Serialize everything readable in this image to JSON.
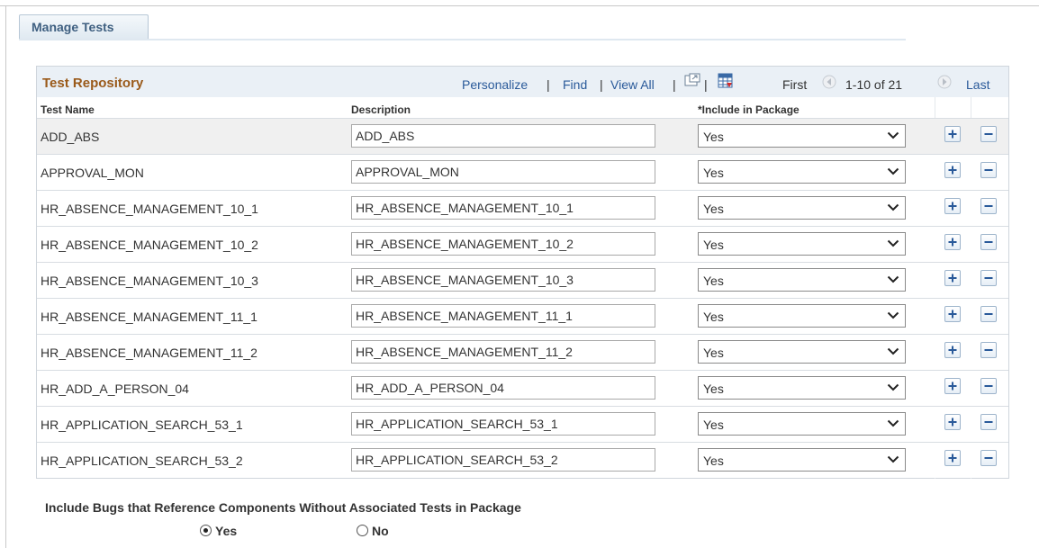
{
  "tab": {
    "label": "Manage Tests"
  },
  "grid": {
    "title": "Test Repository",
    "nav": {
      "personalize": "Personalize",
      "find": "Find",
      "view_all": "View All",
      "first": "First",
      "range": "1-10 of 21",
      "last": "Last"
    },
    "icons": [
      "zoom-icon",
      "download-spreadsheet-icon",
      "prev-arrow-icon",
      "next-arrow-icon",
      "add-row-icon",
      "delete-row-icon"
    ],
    "columns": [
      "Test Name",
      "Description",
      "*Include in Package"
    ],
    "rows": [
      {
        "name": "ADD_ABS",
        "description": "ADD_ABS",
        "include": "Yes"
      },
      {
        "name": "APPROVAL_MON",
        "description": "APPROVAL_MON",
        "include": "Yes"
      },
      {
        "name": "HR_ABSENCE_MANAGEMENT_10_1",
        "description": "HR_ABSENCE_MANAGEMENT_10_1",
        "include": "Yes"
      },
      {
        "name": "HR_ABSENCE_MANAGEMENT_10_2",
        "description": "HR_ABSENCE_MANAGEMENT_10_2",
        "include": "Yes"
      },
      {
        "name": "HR_ABSENCE_MANAGEMENT_10_3",
        "description": "HR_ABSENCE_MANAGEMENT_10_3",
        "include": "Yes"
      },
      {
        "name": "HR_ABSENCE_MANAGEMENT_11_1",
        "description": "HR_ABSENCE_MANAGEMENT_11_1",
        "include": "Yes"
      },
      {
        "name": "HR_ABSENCE_MANAGEMENT_11_2",
        "description": "HR_ABSENCE_MANAGEMENT_11_2",
        "include": "Yes"
      },
      {
        "name": "HR_ADD_A_PERSON_04",
        "description": "HR_ADD_A_PERSON_04",
        "include": "Yes"
      },
      {
        "name": "HR_APPLICATION_SEARCH_53_1",
        "description": "HR_APPLICATION_SEARCH_53_1",
        "include": "Yes"
      },
      {
        "name": "HR_APPLICATION_SEARCH_53_2",
        "description": "HR_APPLICATION_SEARCH_53_2",
        "include": "Yes"
      }
    ]
  },
  "bugs_option": {
    "label": "Include Bugs that Reference Components Without Associated Tests in Package",
    "yes_label": "Yes",
    "no_label": "No",
    "selected": "Yes"
  },
  "colors": {
    "title": "#9a5a1a",
    "link": "#2a5a9a",
    "tab_text": "#3e5f80"
  }
}
